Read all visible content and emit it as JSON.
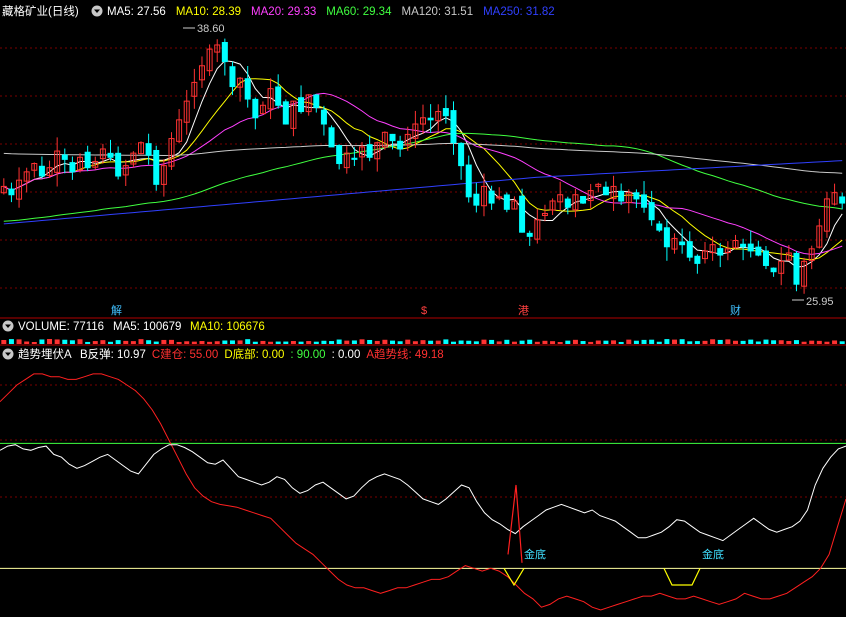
{
  "header": {
    "stock_name": "藏格矿业(日线)",
    "ma": [
      {
        "label": "MA5: 27.56",
        "color": "#ffffff"
      },
      {
        "label": "MA10: 28.39",
        "color": "#ffff00"
      },
      {
        "label": "MA20: 29.33",
        "color": "#ff40ff"
      },
      {
        "label": "MA60: 29.34",
        "color": "#40ff40"
      },
      {
        "label": "MA120: 31.51",
        "color": "#c8c8c8"
      },
      {
        "label": "MA250: 31.82",
        "color": "#3040ff"
      }
    ]
  },
  "volume_header": {
    "title": "VOLUME: 77116",
    "ma5": "MA5: 100679",
    "ma10": "MA10: 106676"
  },
  "indicator_header": {
    "name": "趋势埋伏A",
    "items": [
      {
        "label": "B反弹: 10.97",
        "color": "#ffffff"
      },
      {
        "label": "C建仓: 55.00",
        "color": "#ff3030"
      },
      {
        "label": "D底部: 0.00",
        "color": "#ffff00"
      },
      {
        "label": ": 90.00",
        "color": "#40ff40"
      },
      {
        "label": ": 0.00",
        "color": "#ffffff"
      },
      {
        "label": "A趋势线: 49.18",
        "color": "#ff3030"
      }
    ]
  },
  "annotations": {
    "high_price": "38.60",
    "low_price": "25.95",
    "event_markers": [
      {
        "text": "解",
        "color": "#40c0ff"
      },
      {
        "text": "$",
        "color": "#ff4040"
      },
      {
        "text": "港",
        "color": "#ff4040"
      },
      {
        "text": "财",
        "color": "#40c0ff"
      }
    ],
    "jindi_labels": [
      "金底",
      "金底"
    ]
  },
  "colors": {
    "up": "#ff3232",
    "down": "#00ffff",
    "grid": "#7a0000",
    "separator": "#b00000"
  },
  "chart_data": {
    "type": "candlestick",
    "price_range": [
      25.5,
      39.2
    ],
    "close": [
      31.2,
      30.8,
      31.5,
      31.9,
      32.3,
      31.7,
      32.1,
      32.9,
      32.5,
      31.9,
      32.6,
      32.1,
      32.4,
      33.0,
      32.6,
      31.7,
      32.2,
      32.8,
      33.3,
      32.7,
      31.3,
      32.2,
      33.5,
      34.4,
      35.3,
      36.2,
      37.0,
      37.8,
      38.0,
      37.2,
      36.0,
      36.4,
      35.4,
      34.5,
      35.1,
      35.9,
      35.1,
      34.2,
      35.3,
      34.8,
      35.6,
      35.0,
      34.2,
      33.1,
      32.3,
      32.8,
      32.5,
      33.1,
      32.6,
      33.3,
      33.8,
      33.4,
      33.0,
      33.7,
      34.2,
      34.5,
      34.4,
      34.8,
      34.6,
      33.3,
      32.2,
      30.7,
      30.3,
      31.2,
      30.4,
      30.7,
      30.1,
      30.5,
      29.0,
      28.8,
      29.6,
      29.9,
      30.5,
      30.8,
      30.2,
      30.8,
      30.4,
      31.0,
      31.3,
      30.8,
      31.2,
      30.5,
      30.9,
      30.6,
      30.2,
      29.6,
      29.1,
      28.3,
      28.7,
      28.4,
      27.8,
      27.5,
      28.1,
      28.4,
      27.9,
      28.2,
      28.6,
      28.3,
      28.1,
      27.9,
      27.4,
      27.1,
      27.6,
      28.0,
      26.5,
      27.6,
      28.2,
      29.3,
      30.6,
      30.9,
      30.4
    ],
    "volume_ma5": 100679,
    "volume_ma10": 106676,
    "indicator": {
      "B_rebound": [
        85,
        88,
        89,
        86,
        85,
        87,
        88,
        82,
        80,
        75,
        72,
        74,
        77,
        80,
        82,
        78,
        74,
        70,
        68,
        75,
        82,
        86,
        89,
        89,
        87,
        84,
        80,
        76,
        75,
        78,
        72,
        66,
        64,
        62,
        60,
        62,
        66,
        64,
        58,
        54,
        56,
        60,
        62,
        58,
        54,
        50,
        52,
        58,
        63,
        66,
        68,
        66,
        64,
        60,
        55,
        50,
        48,
        46,
        50,
        55,
        60,
        58,
        48,
        40,
        35,
        32,
        28,
        25,
        30,
        34,
        38,
        42,
        44,
        46,
        44,
        42,
        40,
        42,
        38,
        36,
        34,
        30,
        26,
        22,
        22,
        24,
        26,
        30,
        35,
        34,
        30,
        26,
        24,
        22,
        20,
        24,
        28,
        32,
        36,
        32,
        28,
        26,
        28,
        30,
        34,
        42,
        60,
        72,
        80,
        86,
        88
      ],
      "C_jiancang": 55.0,
      "D_dibu": 0.0,
      "level_90": 90.0,
      "level_0": 0.0,
      "A_trend": [
        120,
        126,
        132,
        136,
        140,
        140,
        138,
        138,
        136,
        136,
        138,
        140,
        140,
        138,
        136,
        132,
        128,
        122,
        114,
        104,
        92,
        80,
        68,
        58,
        52,
        48,
        46,
        45,
        44,
        42,
        40,
        38,
        36,
        30,
        24,
        18,
        14,
        10,
        4,
        -2,
        -8,
        -12,
        -14,
        -14,
        -16,
        -18,
        -16,
        -14,
        -14,
        -12,
        -10,
        -8,
        -8,
        -6,
        -2,
        2,
        0,
        -2,
        0,
        -2,
        -6,
        -12,
        -18,
        -22,
        -28,
        -26,
        -22,
        -20,
        -22,
        -24,
        -28,
        -30,
        -28,
        -26,
        -24,
        -22,
        -20,
        -20,
        -18,
        -20,
        -22,
        -22,
        -20,
        -22,
        -24,
        -26,
        -24,
        -22,
        -18,
        -20,
        -22,
        -22,
        -20,
        -18,
        -14,
        -10,
        -6,
        0,
        10,
        30,
        50
      ],
      "range": [
        -30,
        150
      ]
    }
  }
}
